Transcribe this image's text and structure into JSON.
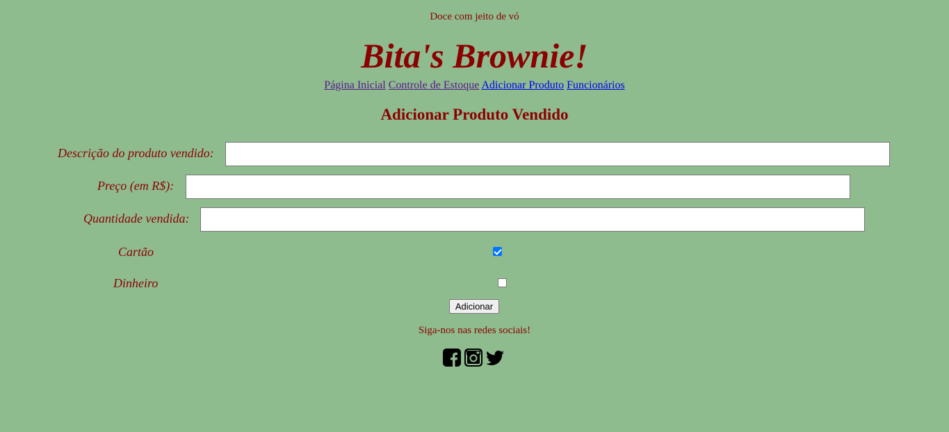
{
  "header": {
    "tagline": "Doce com jeito de vó",
    "brand": "Bita's Brownie!"
  },
  "nav": {
    "items": [
      {
        "label": "Página Inicial"
      },
      {
        "label": "Controle de Estoque"
      },
      {
        "label": "Adicionar Produto"
      },
      {
        "label": "Funcionários"
      }
    ]
  },
  "form": {
    "title": "Adicionar Produto Vendido",
    "description_label": "Descrição do produto vendido:",
    "description_value": "",
    "price_label": "Preço (em R$):",
    "price_value": "",
    "quantity_label": "Quantidade vendida:",
    "quantity_value": "",
    "card_label": "Cartão",
    "card_checked": true,
    "cash_label": "Dinheiro",
    "cash_checked": false,
    "submit_label": "Adicionar"
  },
  "footer": {
    "social_text": "Siga-nos nas redes sociais!",
    "icons": [
      "facebook-icon",
      "instagram-icon",
      "twitter-icon"
    ]
  },
  "colors": {
    "background": "#8fbc8f",
    "text_accent": "#8b0000",
    "link": "#0000ee",
    "link_visited": "#551a8b",
    "checkbox_checked": "#0075ff"
  }
}
